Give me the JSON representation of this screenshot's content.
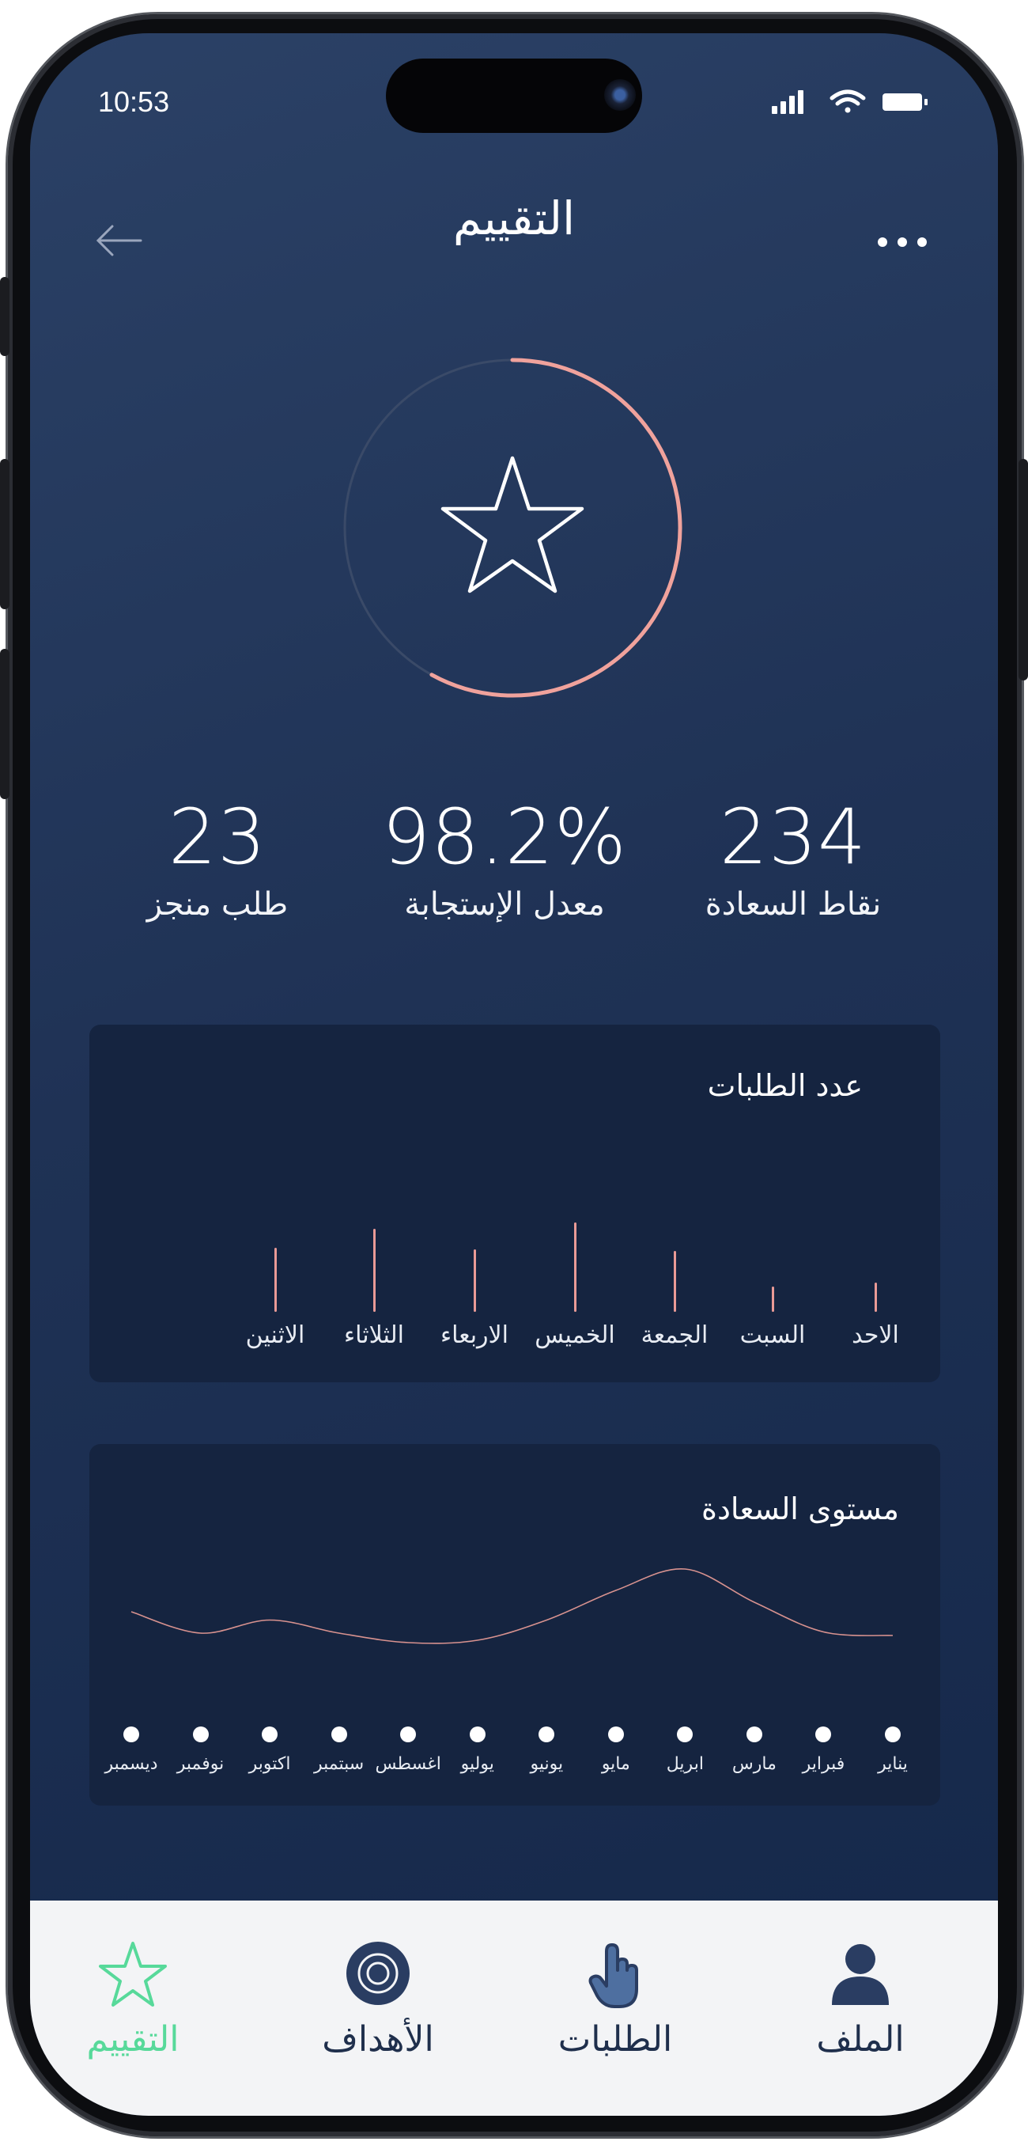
{
  "status_bar": {
    "time": "10:53"
  },
  "header": {
    "title": "التقييم"
  },
  "stats": [
    {
      "value": "234",
      "label": "نقاط السعادة"
    },
    {
      "value": "98.2%",
      "label": "معدل الإستجابة"
    },
    {
      "value": "23",
      "label": "طلب منجز"
    }
  ],
  "rating_ring": {
    "progress": 0.58,
    "track_color": "#3a4a68",
    "progress_color": "#f0a29c"
  },
  "orders_chart": {
    "title": "عدد الطلبات",
    "chart_data": {
      "type": "bar",
      "categories": [
        "الاحد",
        "السبت",
        "الجمعة",
        "الخميس",
        "الاربعاء",
        "الثلاثاء",
        "الاثنين"
      ],
      "values": [
        37,
        32,
        77,
        113,
        79,
        105,
        81
      ],
      "ylim": [
        0,
        120
      ]
    }
  },
  "happiness_chart": {
    "title": "مستوى السعادة",
    "chart_data": {
      "type": "line",
      "categories": [
        "يناير",
        "فبراير",
        "مارس",
        "ابريل",
        "مايو",
        "يونيو",
        "يوليو",
        "اغسطس",
        "سبتمبر",
        "اكتوبر",
        "نوفمبر",
        "ديسمبر"
      ],
      "values": [
        42,
        45,
        70,
        98,
        80,
        55,
        38,
        36,
        44,
        55,
        44,
        62
      ],
      "ylim": [
        0,
        120
      ]
    }
  },
  "tab_bar": {
    "items": [
      {
        "label": "الملف",
        "icon": "user-icon"
      },
      {
        "label": "الطلبات",
        "icon": "hand-pointer-icon"
      },
      {
        "label": "الأهداف",
        "icon": "target-icon"
      },
      {
        "label": "التقييم",
        "icon": "star-icon",
        "active": true
      }
    ],
    "active_color": "#57d99a"
  }
}
